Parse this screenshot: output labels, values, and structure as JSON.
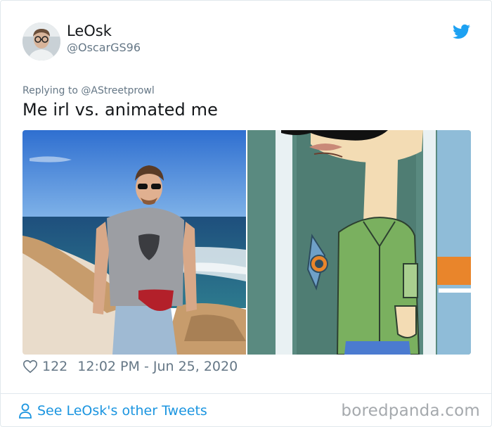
{
  "author": {
    "display_name": "LeOsk",
    "handle": "@OscarGS96",
    "avatar_icon": "user-avatar-photo"
  },
  "reply": {
    "label": "Replying to @AStreetprowl"
  },
  "tweet": {
    "text": "Me irl vs. animated me",
    "likes": "122",
    "timestamp": "12:02 PM - Jun 25, 2020"
  },
  "footer": {
    "see_more_label": "See LeOsk's other Tweets",
    "watermark": "boredpanda.com"
  },
  "icons": {
    "brand": "twitter-bird-icon",
    "like": "heart-icon",
    "profile": "person-icon"
  },
  "colors": {
    "link": "#1b95e0",
    "muted": "#657786",
    "text": "#14171a",
    "border": "#e1e8ed",
    "brand": "#1da1f2"
  }
}
